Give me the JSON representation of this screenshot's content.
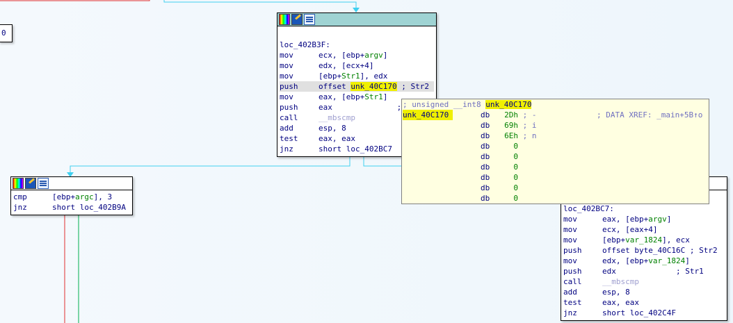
{
  "nodes": {
    "main": {
      "label": "loc_402B3F:",
      "lines": [
        {
          "mn": "mov",
          "pre": "ecx, [ebp+",
          "var": "argv",
          "post": "]"
        },
        {
          "mn": "mov",
          "pre": "edx, [ecx+4]"
        },
        {
          "mn": "mov",
          "pre": "[ebp+",
          "var": "Str1",
          "post": "], edx"
        },
        {
          "mn": "push",
          "pre": "offset ",
          "hy": "unk_40C170",
          "post": " ; Str2"
        },
        {
          "mn": "mov",
          "pre": "eax, [ebp+",
          "var": "Str1",
          "post": "]"
        },
        {
          "mn": "push",
          "pre": "eax",
          "post": "              ;"
        },
        {
          "mn": "call",
          "fn": "__mbscmp"
        },
        {
          "mn": "add",
          "pre": "esp, 8"
        },
        {
          "mn": "test",
          "pre": "eax, eax"
        },
        {
          "mn": "jnz",
          "pre": "short loc_402BC7"
        }
      ]
    },
    "left": {
      "lines": [
        {
          "mn": "cmp",
          "pre": "[ebp+",
          "var": "argc",
          "post": "], 3"
        },
        {
          "mn": "jnz",
          "pre": "short loc_402B9A"
        }
      ]
    },
    "right": {
      "label": "loc_402BC7:",
      "lines": [
        {
          "mn": "mov",
          "pre": "eax, [ebp+",
          "var": "argv",
          "post": "]"
        },
        {
          "mn": "mov",
          "pre": "ecx, [eax+4]"
        },
        {
          "mn": "mov",
          "pre": "[ebp+",
          "var": "var_1824",
          "post": "], ecx"
        },
        {
          "mn": "push",
          "pre": "offset byte_40C16C ; Str2"
        },
        {
          "mn": "mov",
          "pre": "edx, [ebp+",
          "var": "var_1824",
          "post": "]"
        },
        {
          "mn": "push",
          "pre": "edx",
          "post": "             ; Str1"
        },
        {
          "mn": "call",
          "fn": "__mbscmp"
        },
        {
          "mn": "add",
          "pre": "esp, 8"
        },
        {
          "mn": "test",
          "pre": "eax, eax"
        },
        {
          "mn": "jnz",
          "pre": "short loc_402C4F"
        }
      ]
    },
    "topleft_fragment": "0"
  },
  "popup": {
    "decl_comment": "; unsigned __int8 ",
    "decl_name": "unk_40C170",
    "first_label": "unk_40C170",
    "xref": "; DATA XREF: _main+5B↑o",
    "rows": [
      {
        "db": "db",
        "val": "2Dh",
        "cm": "; -"
      },
      {
        "db": "db",
        "val": "69h",
        "cm": "; i"
      },
      {
        "db": "db",
        "val": "6Eh",
        "cm": "; n"
      },
      {
        "db": "db",
        "val": "0",
        "cm": ""
      },
      {
        "db": "db",
        "val": "0",
        "cm": ""
      },
      {
        "db": "db",
        "val": "0",
        "cm": ""
      },
      {
        "db": "db",
        "val": "0",
        "cm": ""
      },
      {
        "db": "db",
        "val": "0",
        "cm": ""
      },
      {
        "db": "db",
        "val": "0",
        "cm": ""
      }
    ]
  },
  "colors": {
    "edge_true": "#00b050",
    "edge_false": "#e03030",
    "edge_uncond": "#40d0f0"
  }
}
